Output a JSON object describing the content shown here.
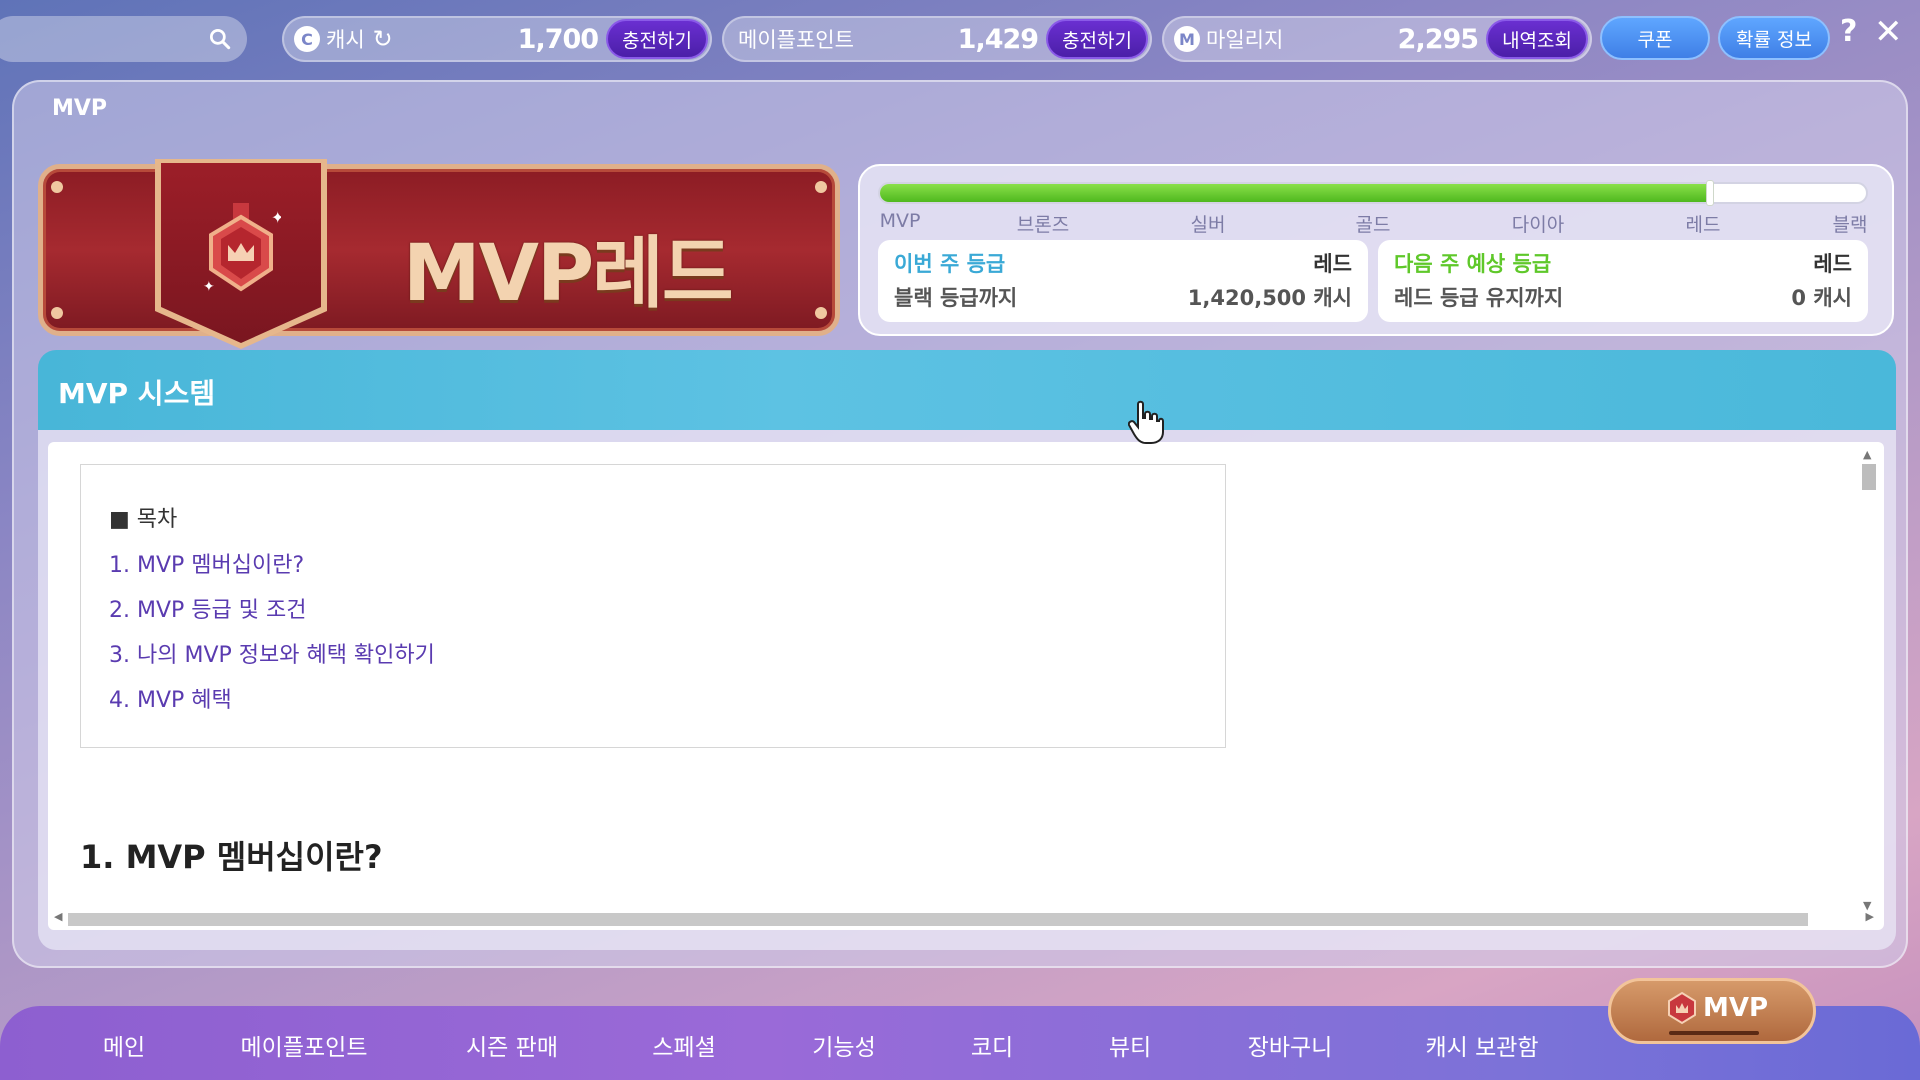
{
  "topbar": {
    "cash_label": "캐시",
    "cash_value": "1,700",
    "cash_charge": "충전하기",
    "maplepoint_label": "메이플포인트",
    "maplepoint_value": "1,429",
    "maplepoint_charge": "충전하기",
    "mileage_label": "마일리지",
    "mileage_value": "2,295",
    "mileage_history": "내역조회",
    "coupon": "쿠폰",
    "probability": "확률 정보",
    "help": "?",
    "close": "✕"
  },
  "panel": {
    "title": "MVP",
    "banner_text": "MVP레드"
  },
  "grade": {
    "progress": 0.84,
    "labels": [
      "MVP",
      "브론즈",
      "실버",
      "골드",
      "다이아",
      "레드",
      "블랙"
    ],
    "this_week_title": "이번 주 등급",
    "this_week_value": "레드",
    "this_week_sub": "블랙 등급까지",
    "this_week_sub_value": "1,420,500 캐시",
    "next_week_title": "다음 주 예상 등급",
    "next_week_value": "레드",
    "next_week_sub": "레드 등급 유지까지",
    "next_week_sub_value": "0 캐시"
  },
  "system": {
    "title": "MVP 시스템",
    "toc_head": "■ 목차",
    "toc": [
      "1. MVP 멤버십이란?",
      "2. MVP 등급 및 조건",
      "3. 나의 MVP 정보와 혜택 확인하기",
      "4. MVP 혜택"
    ],
    "section_title": "1. MVP 멤버십이란?"
  },
  "nav": {
    "items": [
      "메인",
      "메이플포인트",
      "시즌 판매",
      "스페셜",
      "기능성",
      "코디",
      "뷰티",
      "장바구니",
      "캐시 보관함"
    ],
    "mvp_button": "MVP"
  },
  "colors": {
    "accent_blue": "#4ab8da",
    "purple_button": "#5a25bd",
    "progress_green": "#5fc82a",
    "banner_red": "#9a2229"
  }
}
